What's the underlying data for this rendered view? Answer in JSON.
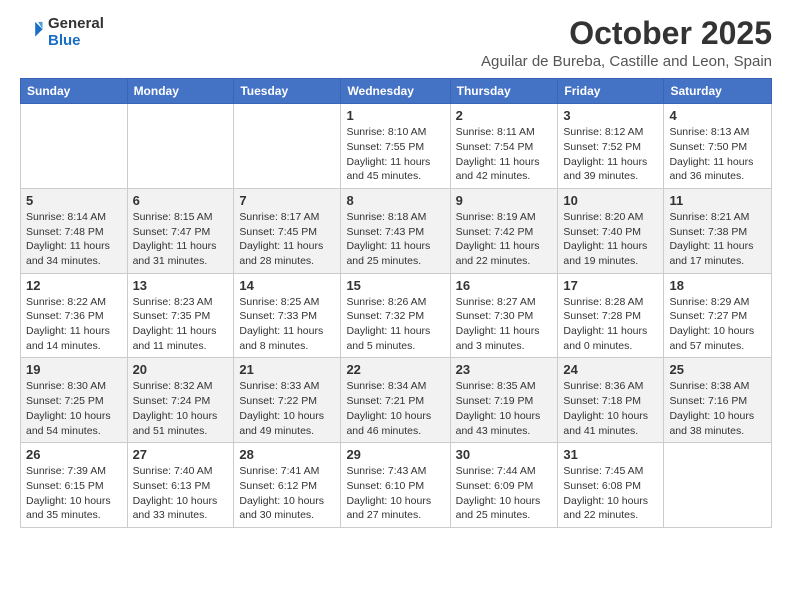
{
  "header": {
    "logo_line1": "General",
    "logo_line2": "Blue",
    "month_title": "October 2025",
    "location": "Aguilar de Bureba, Castille and Leon, Spain"
  },
  "weekdays": [
    "Sunday",
    "Monday",
    "Tuesday",
    "Wednesday",
    "Thursday",
    "Friday",
    "Saturday"
  ],
  "weeks": [
    [
      {
        "day": "",
        "info": ""
      },
      {
        "day": "",
        "info": ""
      },
      {
        "day": "",
        "info": ""
      },
      {
        "day": "1",
        "info": "Sunrise: 8:10 AM\nSunset: 7:55 PM\nDaylight: 11 hours\nand 45 minutes."
      },
      {
        "day": "2",
        "info": "Sunrise: 8:11 AM\nSunset: 7:54 PM\nDaylight: 11 hours\nand 42 minutes."
      },
      {
        "day": "3",
        "info": "Sunrise: 8:12 AM\nSunset: 7:52 PM\nDaylight: 11 hours\nand 39 minutes."
      },
      {
        "day": "4",
        "info": "Sunrise: 8:13 AM\nSunset: 7:50 PM\nDaylight: 11 hours\nand 36 minutes."
      }
    ],
    [
      {
        "day": "5",
        "info": "Sunrise: 8:14 AM\nSunset: 7:48 PM\nDaylight: 11 hours\nand 34 minutes."
      },
      {
        "day": "6",
        "info": "Sunrise: 8:15 AM\nSunset: 7:47 PM\nDaylight: 11 hours\nand 31 minutes."
      },
      {
        "day": "7",
        "info": "Sunrise: 8:17 AM\nSunset: 7:45 PM\nDaylight: 11 hours\nand 28 minutes."
      },
      {
        "day": "8",
        "info": "Sunrise: 8:18 AM\nSunset: 7:43 PM\nDaylight: 11 hours\nand 25 minutes."
      },
      {
        "day": "9",
        "info": "Sunrise: 8:19 AM\nSunset: 7:42 PM\nDaylight: 11 hours\nand 22 minutes."
      },
      {
        "day": "10",
        "info": "Sunrise: 8:20 AM\nSunset: 7:40 PM\nDaylight: 11 hours\nand 19 minutes."
      },
      {
        "day": "11",
        "info": "Sunrise: 8:21 AM\nSunset: 7:38 PM\nDaylight: 11 hours\nand 17 minutes."
      }
    ],
    [
      {
        "day": "12",
        "info": "Sunrise: 8:22 AM\nSunset: 7:36 PM\nDaylight: 11 hours\nand 14 minutes."
      },
      {
        "day": "13",
        "info": "Sunrise: 8:23 AM\nSunset: 7:35 PM\nDaylight: 11 hours\nand 11 minutes."
      },
      {
        "day": "14",
        "info": "Sunrise: 8:25 AM\nSunset: 7:33 PM\nDaylight: 11 hours\nand 8 minutes."
      },
      {
        "day": "15",
        "info": "Sunrise: 8:26 AM\nSunset: 7:32 PM\nDaylight: 11 hours\nand 5 minutes."
      },
      {
        "day": "16",
        "info": "Sunrise: 8:27 AM\nSunset: 7:30 PM\nDaylight: 11 hours\nand 3 minutes."
      },
      {
        "day": "17",
        "info": "Sunrise: 8:28 AM\nSunset: 7:28 PM\nDaylight: 11 hours\nand 0 minutes."
      },
      {
        "day": "18",
        "info": "Sunrise: 8:29 AM\nSunset: 7:27 PM\nDaylight: 10 hours\nand 57 minutes."
      }
    ],
    [
      {
        "day": "19",
        "info": "Sunrise: 8:30 AM\nSunset: 7:25 PM\nDaylight: 10 hours\nand 54 minutes."
      },
      {
        "day": "20",
        "info": "Sunrise: 8:32 AM\nSunset: 7:24 PM\nDaylight: 10 hours\nand 51 minutes."
      },
      {
        "day": "21",
        "info": "Sunrise: 8:33 AM\nSunset: 7:22 PM\nDaylight: 10 hours\nand 49 minutes."
      },
      {
        "day": "22",
        "info": "Sunrise: 8:34 AM\nSunset: 7:21 PM\nDaylight: 10 hours\nand 46 minutes."
      },
      {
        "day": "23",
        "info": "Sunrise: 8:35 AM\nSunset: 7:19 PM\nDaylight: 10 hours\nand 43 minutes."
      },
      {
        "day": "24",
        "info": "Sunrise: 8:36 AM\nSunset: 7:18 PM\nDaylight: 10 hours\nand 41 minutes."
      },
      {
        "day": "25",
        "info": "Sunrise: 8:38 AM\nSunset: 7:16 PM\nDaylight: 10 hours\nand 38 minutes."
      }
    ],
    [
      {
        "day": "26",
        "info": "Sunrise: 7:39 AM\nSunset: 6:15 PM\nDaylight: 10 hours\nand 35 minutes."
      },
      {
        "day": "27",
        "info": "Sunrise: 7:40 AM\nSunset: 6:13 PM\nDaylight: 10 hours\nand 33 minutes."
      },
      {
        "day": "28",
        "info": "Sunrise: 7:41 AM\nSunset: 6:12 PM\nDaylight: 10 hours\nand 30 minutes."
      },
      {
        "day": "29",
        "info": "Sunrise: 7:43 AM\nSunset: 6:10 PM\nDaylight: 10 hours\nand 27 minutes."
      },
      {
        "day": "30",
        "info": "Sunrise: 7:44 AM\nSunset: 6:09 PM\nDaylight: 10 hours\nand 25 minutes."
      },
      {
        "day": "31",
        "info": "Sunrise: 7:45 AM\nSunset: 6:08 PM\nDaylight: 10 hours\nand 22 minutes."
      },
      {
        "day": "",
        "info": ""
      }
    ]
  ]
}
